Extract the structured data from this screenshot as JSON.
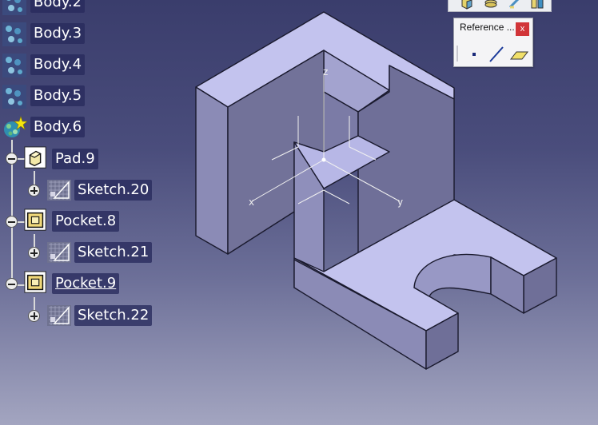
{
  "tree": {
    "bodies": [
      {
        "label": "Body.2",
        "icon": "body-icon"
      },
      {
        "label": "Body.3",
        "icon": "body-icon"
      },
      {
        "label": "Body.4",
        "icon": "body-icon"
      },
      {
        "label": "Body.5",
        "icon": "body-icon"
      },
      {
        "label": "Body.6",
        "icon": "body-in-work-object-icon"
      }
    ],
    "features": [
      {
        "label": "Pad.9",
        "icon": "pad-icon",
        "sketch": "Sketch.20"
      },
      {
        "label": "Pocket.8",
        "icon": "pocket-icon",
        "sketch": "Sketch.21"
      },
      {
        "label": "Pocket.9",
        "icon": "pocket-icon",
        "sketch": "Sketch.22",
        "current": true
      }
    ]
  },
  "axis": {
    "x": "x",
    "y": "y",
    "z": "z"
  },
  "toolbars": {
    "reference": {
      "title": "Reference ...",
      "close": "x",
      "buttons": [
        "point-icon",
        "line-icon",
        "plane-icon"
      ]
    },
    "top_icons": [
      "pad-toolbar-icon",
      "stack-toolbar-icon",
      "edit-toolbar-icon",
      "catalog-toolbar-icon"
    ]
  },
  "colors": {
    "part_top": "#c3c3ee",
    "part_front": "#8b8bb6",
    "part_side": "#6f6f98",
    "background_top": "#3a3d6c",
    "background_bottom": "#a3a5c0"
  }
}
